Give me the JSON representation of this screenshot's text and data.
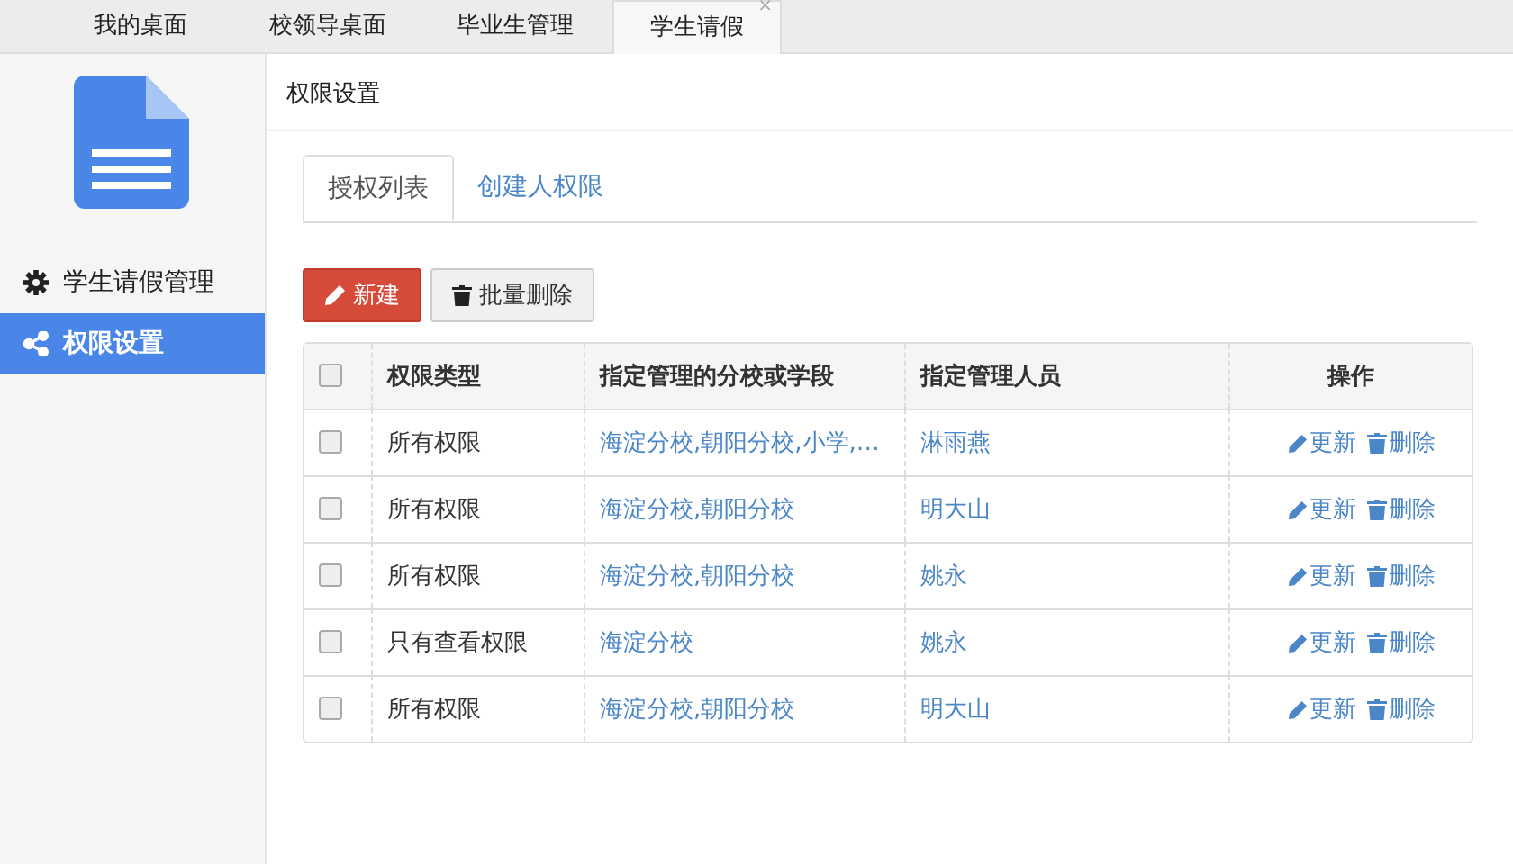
{
  "top_tabs": [
    {
      "label": "我的桌面",
      "selected": false
    },
    {
      "label": "校领导桌面",
      "selected": false
    },
    {
      "label": "毕业生管理",
      "selected": false
    },
    {
      "label": "学生请假",
      "selected": true,
      "close": "×"
    }
  ],
  "sidebar": {
    "items": [
      {
        "label": "学生请假管理",
        "kind": "gear",
        "selected": false
      },
      {
        "label": "权限设置",
        "kind": "share",
        "selected": true
      }
    ]
  },
  "page_title": "权限设置",
  "tabs": [
    {
      "label": "授权列表",
      "selected": true
    },
    {
      "label": "创建人权限",
      "selected": false
    }
  ],
  "buttons": [
    {
      "label": "新建",
      "kind": "primary"
    },
    {
      "label": "批量删除",
      "kind": "default"
    }
  ],
  "table": {
    "header_checked": false,
    "columns": [
      "权限类型",
      "指定管理的分校或学段",
      "指定管理人员",
      "操作"
    ],
    "rows": [
      {
        "checked": false,
        "type": "所有权限",
        "scope": "海淀分校,朝阳分校,小学,…",
        "person": "淋雨燕",
        "update": "更新",
        "delete": "删除"
      },
      {
        "checked": false,
        "type": "所有权限",
        "scope": "海淀分校,朝阳分校",
        "person": "明大山",
        "update": "更新",
        "delete": "删除"
      },
      {
        "checked": false,
        "type": "所有权限",
        "scope": "海淀分校,朝阳分校",
        "person": "姚永",
        "update": "更新",
        "delete": "删除"
      },
      {
        "checked": false,
        "type": "只有查看权限",
        "scope": "海淀分校",
        "person": "姚永",
        "update": "更新",
        "delete": "删除"
      },
      {
        "checked": false,
        "type": "所有权限",
        "scope": "海淀分校,朝阳分校",
        "person": "明大山",
        "update": "更新",
        "delete": "删除"
      }
    ]
  }
}
